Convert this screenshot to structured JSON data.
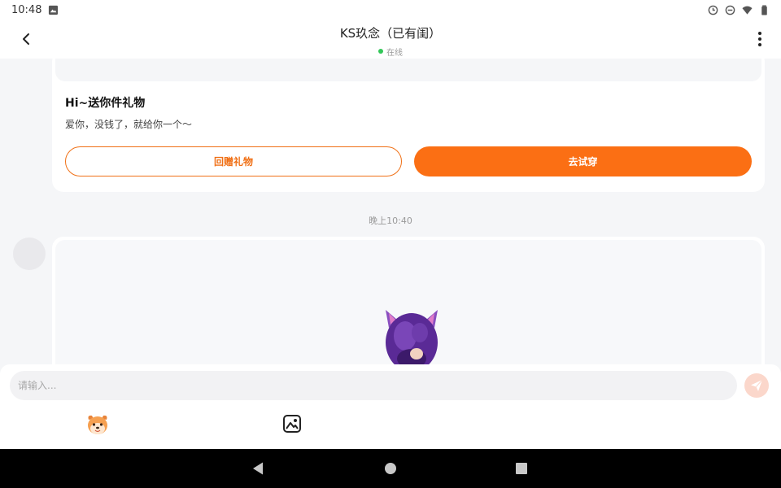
{
  "status_bar": {
    "time": "10:48",
    "icons": [
      "photo-icon",
      "sync-icon",
      "dnd-icon",
      "wifi-icon",
      "battery-icon"
    ]
  },
  "header": {
    "title": "KS玖念（已有闺）",
    "status": "在线",
    "status_color": "#34c759"
  },
  "gift_message": {
    "title": "Hi~送你件礼物",
    "description": "爱你，没钱了，就给你一个～",
    "return_button": "回赠礼物",
    "try_button": "去试穿",
    "accent_color": "#fb6f14"
  },
  "timestamp": "晚上10:40",
  "composer": {
    "placeholder": "请输入...",
    "value": "",
    "send_icon": "send-icon",
    "tools": [
      "emoji-icon",
      "image-icon"
    ]
  },
  "nav": {
    "buttons": [
      "back-icon",
      "home-icon",
      "recents-icon"
    ]
  }
}
